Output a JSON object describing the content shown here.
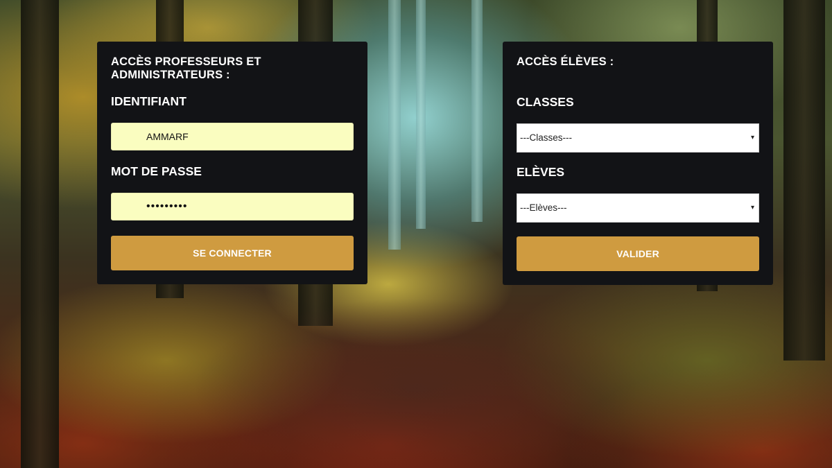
{
  "teacher_panel": {
    "title": "ACCÈS PROFESSEURS ET ADMINISTRATEURS :",
    "id_label": "IDENTIFIANT",
    "id_value": "AMMARF",
    "password_label": "MOT DE PASSE",
    "password_value": "•••••••••",
    "connect_label": "SE CONNECTER"
  },
  "student_panel": {
    "title": "ACCÈS ÉLÈVES :",
    "classes_label": "CLASSES",
    "classes_selected": "---Classes---",
    "students_label": "ELÈVES",
    "students_selected": "---Elèves---",
    "validate_label": "VALIDER"
  },
  "icons": {
    "select_arrow": "▾"
  },
  "colors": {
    "panel_bg": "#121316",
    "input_bg": "#fafdc0",
    "button_bg": "#cf9b40"
  }
}
